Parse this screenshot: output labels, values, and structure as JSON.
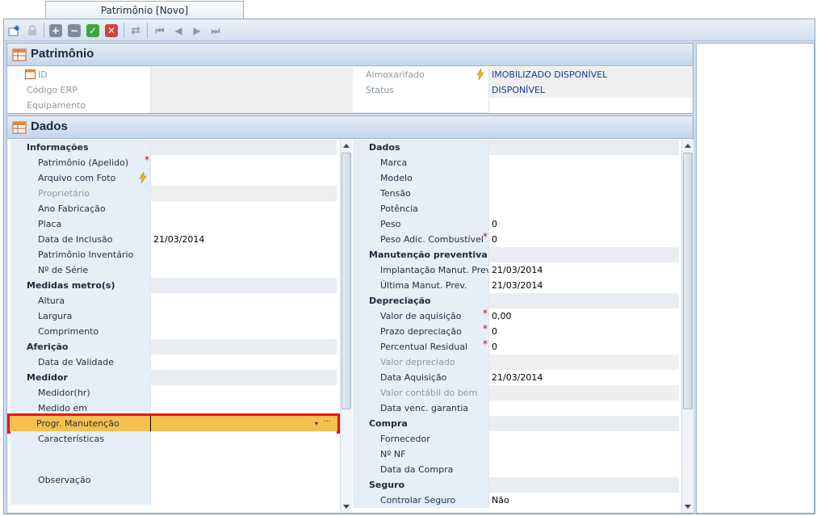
{
  "tab": {
    "title": "Patrimônio [Novo]"
  },
  "toolbar": {
    "icons": [
      "new-record-icon",
      "lock-icon",
      "add-icon",
      "remove-icon",
      "confirm-icon",
      "cancel-icon",
      "refresh-icon",
      "first-record-icon",
      "previous-record-icon",
      "next-record-icon",
      "last-record-icon"
    ]
  },
  "header": {
    "title": "Patrimônio",
    "left": [
      {
        "label": "ID",
        "value": ""
      },
      {
        "label": "Código ERP",
        "value": ""
      },
      {
        "label": "Equipamento",
        "value": ""
      }
    ],
    "right": [
      {
        "label": "Almoxarifado",
        "value": "IMOBILIZADO DISPONÍVEL"
      },
      {
        "label": "Status",
        "value": "DISPONÍVEL"
      }
    ]
  },
  "dados": {
    "title": "Dados",
    "left": [
      {
        "label": "Informações",
        "category": true
      },
      {
        "label": "Patrimônio (Apelido)",
        "value": "",
        "required": true
      },
      {
        "label": "Arquivo com Foto",
        "value": "",
        "bolt": true
      },
      {
        "label": "Proprietário",
        "value": "",
        "disabled": true
      },
      {
        "label": "Ano Fabricação",
        "value": ""
      },
      {
        "label": "Placa",
        "value": ""
      },
      {
        "label": "Data de Inclusão",
        "value": "21/03/2014"
      },
      {
        "label": "Patrimônio Inventário",
        "value": ""
      },
      {
        "label": "Nº de Série",
        "value": ""
      },
      {
        "label": "Medidas metro(s)",
        "category": true
      },
      {
        "label": "Altura",
        "value": ""
      },
      {
        "label": "Largura",
        "value": ""
      },
      {
        "label": "Comprimento",
        "value": ""
      },
      {
        "label": "Aferição",
        "category": true
      },
      {
        "label": "Data de Validade",
        "value": ""
      },
      {
        "label": "Medidor",
        "category": true
      },
      {
        "label": "Medidor(hr)",
        "value": ""
      },
      {
        "label": "Medido em",
        "value": ""
      },
      {
        "label": "Progr. Manutenção",
        "value": "",
        "selected": true
      },
      {
        "label": "Características",
        "value": "",
        "tall": true
      },
      {
        "label": "Observação",
        "value": "",
        "tall2": true
      }
    ],
    "right": [
      {
        "label": "Dados",
        "category": true
      },
      {
        "label": "Marca",
        "value": ""
      },
      {
        "label": "Modelo",
        "value": ""
      },
      {
        "label": "Tensão",
        "value": ""
      },
      {
        "label": "Potência",
        "value": ""
      },
      {
        "label": "Peso",
        "value": "0"
      },
      {
        "label": "Peso Adic. Combustível",
        "value": "0",
        "required": true
      },
      {
        "label": "Manutenção preventiva",
        "category": true
      },
      {
        "label": "Implantação Manut. Prev.",
        "value": "21/03/2014"
      },
      {
        "label": "Última Manut. Prev.",
        "value": "21/03/2014"
      },
      {
        "label": "Depreciação",
        "category": true
      },
      {
        "label": "Valor de aquisição",
        "value": "0,00",
        "required": true
      },
      {
        "label": "Prazo depreciação",
        "value": "0",
        "required": true
      },
      {
        "label": "Percentual Residual",
        "value": "0",
        "required": true
      },
      {
        "label": "Valor depreciado",
        "value": "",
        "disabled": true
      },
      {
        "label": "Data Aquisição",
        "value": "21/03/2014"
      },
      {
        "label": "Valor contábil do bem",
        "value": "",
        "disabled": true
      },
      {
        "label": "Data venc. garantia",
        "value": ""
      },
      {
        "label": "Compra",
        "category": true
      },
      {
        "label": "Fornecedor",
        "value": ""
      },
      {
        "label": "Nº NF",
        "value": ""
      },
      {
        "label": "Data da Compra",
        "value": ""
      },
      {
        "label": "Seguro",
        "category": true
      },
      {
        "label": "Controlar Seguro",
        "value": "Não"
      }
    ]
  },
  "colors": {
    "highlight": "#f5c04f",
    "highlight_border": "#e8141a",
    "required": "#d40000"
  }
}
